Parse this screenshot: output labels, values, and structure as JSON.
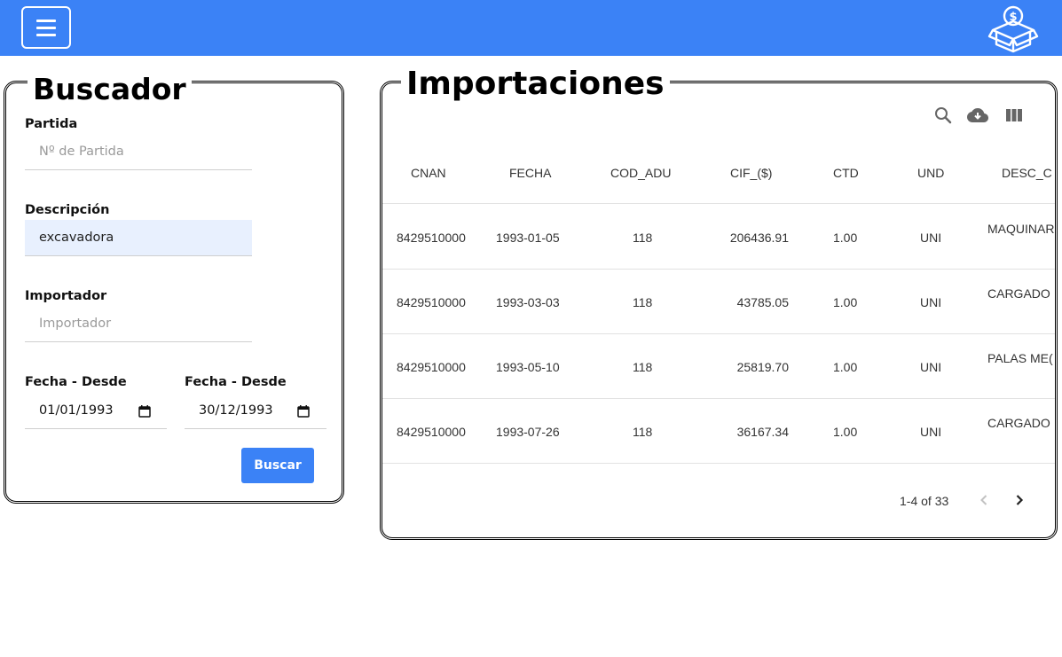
{
  "header": {
    "menu_icon": "hamburger-icon",
    "logo_icon": "money-box-icon",
    "accent_color": "#3b82f6"
  },
  "search_panel": {
    "title": "Buscador",
    "partida": {
      "label": "Partida",
      "placeholder": "Nº de Partida",
      "value": ""
    },
    "descripcion": {
      "label": "Descripción",
      "placeholder": "",
      "value": "excavadora"
    },
    "importador": {
      "label": "Importador",
      "placeholder": "Importador",
      "value": ""
    },
    "fecha_desde": {
      "label": "Fecha - Desde",
      "value": "01/01/1993"
    },
    "fecha_hasta": {
      "label": "Fecha - Desde",
      "value": "30/12/1993"
    },
    "search_button": "Buscar"
  },
  "results_panel": {
    "title": "Importaciones",
    "toolbar_icons": [
      "search-icon",
      "cloud-download-icon",
      "view-columns-icon"
    ],
    "columns": [
      "CNAN",
      "FECHA",
      "COD_ADU",
      "CIF_($)",
      "CTD",
      "UND",
      "DESC_C"
    ],
    "rows": [
      [
        "8429510000",
        "1993-01-05",
        "118",
        "206436.91",
        "1.00",
        "UNI",
        "MAQUINAR"
      ],
      [
        "8429510000",
        "1993-03-03",
        "118",
        "43785.05",
        "1.00",
        "UNI",
        "CARGADO"
      ],
      [
        "8429510000",
        "1993-05-10",
        "118",
        "25819.70",
        "1.00",
        "UNI",
        "PALAS ME("
      ],
      [
        "8429510000",
        "1993-07-26",
        "118",
        "36167.34",
        "1.00",
        "UNI",
        "CARGADO"
      ]
    ],
    "pagination": "1-4 of 33"
  }
}
